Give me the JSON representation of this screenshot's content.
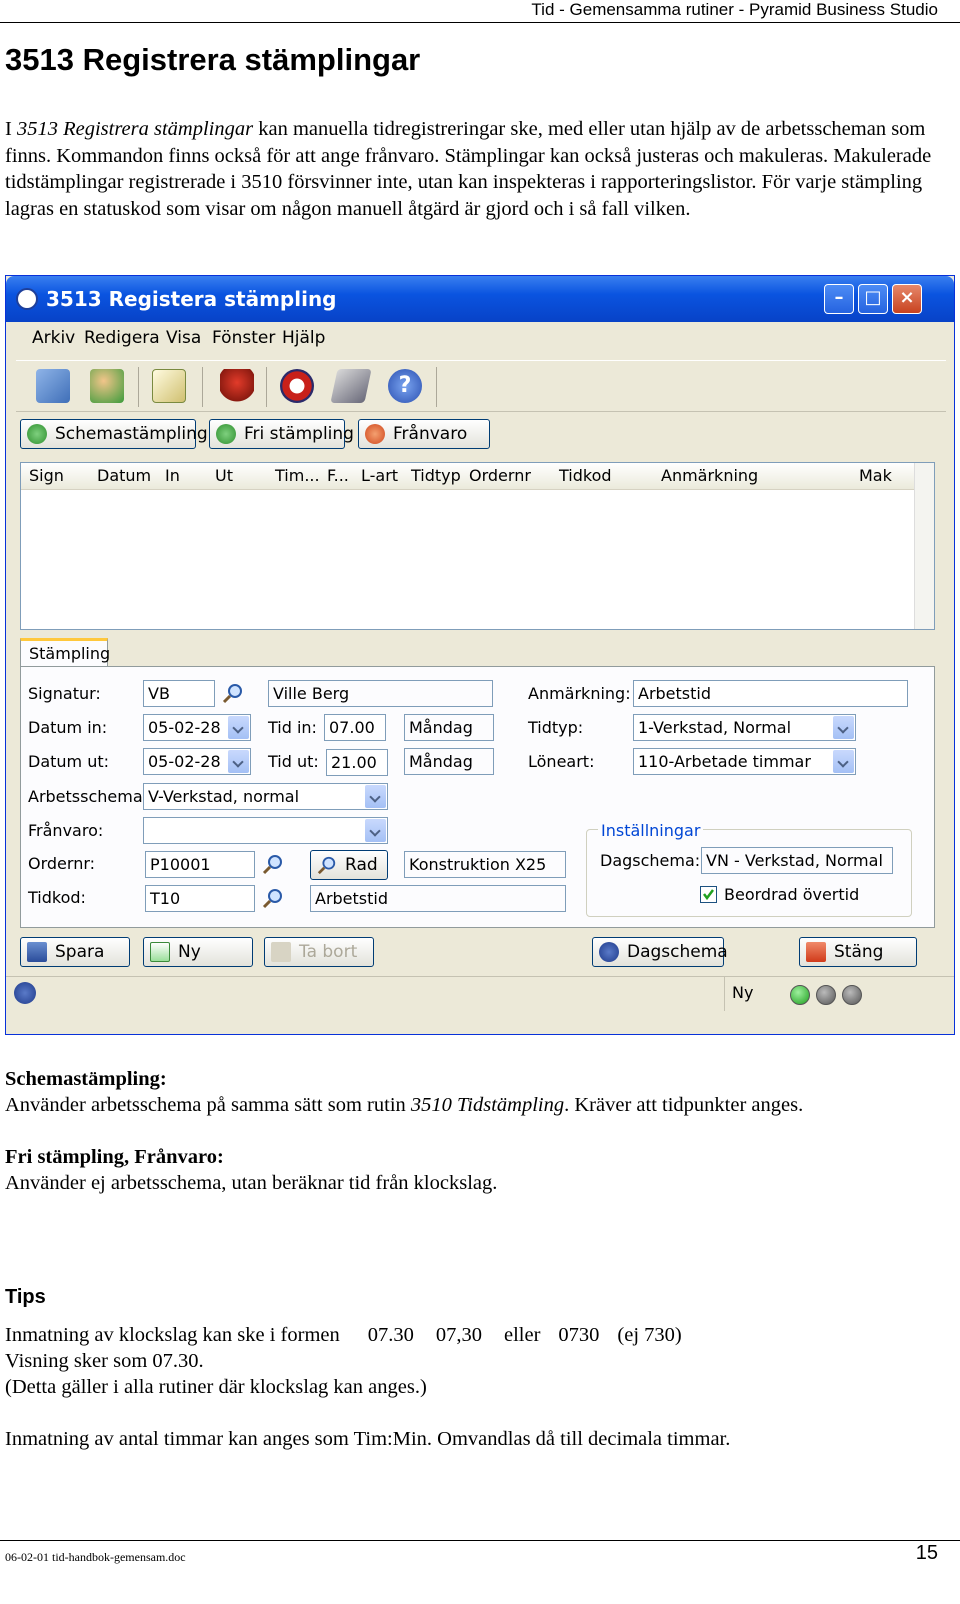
{
  "header": {
    "title": "Tid - Gemensamma rutiner - Pyramid Business Studio"
  },
  "heading": "3513 Registrera stämplingar",
  "intro": {
    "prefix": "I ",
    "italic": "3513 Registrera stämplingar",
    "rest": " kan manuella tidregistreringar ske, med eller utan hjälp av de arbetsscheman som finns. Kommandon finns också för att ange frånvaro. Stämplingar kan också justeras och makuleras. Makulerade tidstämplingar registrerade i 3510 försvinner inte, utan kan inspekteras i rapporteringslistor. För varje stämpling lagras en statuskod som visar om någon manuell åtgärd är gjord och i så fall vilken."
  },
  "window": {
    "title": "3513 Registera stämpling",
    "menu": [
      "Arkiv",
      "Redigera",
      "Visa",
      "Fönster",
      "Hjälp"
    ],
    "mode_buttons": [
      "Schemastämpling",
      "Fri stämpling",
      "Frånvaro"
    ],
    "grid_columns": [
      "Sign",
      "Datum",
      "In",
      "Ut",
      "Tim...",
      "F...",
      "L-art",
      "Tidtyp",
      "Ordernr",
      "Tidkod",
      "Anmärkning",
      "Mak"
    ],
    "tab": "Stämpling",
    "labels": {
      "signatur": "Signatur:",
      "datum_in": "Datum in:",
      "datum_ut": "Datum ut:",
      "arbetsschema": "Arbetsschema:",
      "franvaro": "Frånvaro:",
      "ordernr": "Ordernr:",
      "tidkod": "Tidkod:",
      "tid_in": "Tid in:",
      "tid_ut": "Tid ut:",
      "anmarkning": "Anmärkning:",
      "tidtyp": "Tidtyp:",
      "loneart": "Löneart:"
    },
    "values": {
      "signatur": "VB",
      "namn": "Ville Berg",
      "datum_in": "05-02-28",
      "datum_ut": "05-02-28",
      "tid_in": "07.00",
      "tid_ut": "21.00",
      "dag_in": "Måndag",
      "dag_ut": "Måndag",
      "arbetsschema": "V-Verkstad, normal",
      "franvaro": "",
      "ordernr": "P10001",
      "rad_button": "Rad",
      "order_text": "Konstruktion X25",
      "tidkod": "T10",
      "tidkod_text": "Arbetstid",
      "anmarkning": "Arbetstid",
      "tidtyp": "1-Verkstad, Normal",
      "loneart": "110-Arbetade timmar"
    },
    "settings": {
      "title": "Inställningar",
      "dagschema_label": "Dagschema:",
      "dagschema_value": "VN - Verkstad, Normal",
      "checkbox_label": "Beordrad övertid",
      "checked": true
    },
    "bottom_buttons": {
      "spara": "Spara",
      "ny": "Ny",
      "ta_bort": "Ta bort",
      "dagschema": "Dagschema",
      "stang": "Stäng"
    },
    "status": {
      "mode": "Ny"
    }
  },
  "sections": [
    {
      "title": "Schemastämpling:",
      "text_before": "Använder arbetsschema på samma sätt som rutin ",
      "italic": "3510 Tidstämpling",
      "text_after": ".  Kräver att tidpunkter anges."
    },
    {
      "title": "Fri stämpling, Frånvaro:",
      "text": "Använder ej arbetsschema, utan beräknar tid från klockslag."
    }
  ],
  "tips": {
    "title": "Tips",
    "line1_prefix": "Inmatning av klockslag kan ske i formen",
    "line1_a": "07.30",
    "line1_b": "07,30",
    "line1_c": "eller",
    "line1_d": "0730",
    "line1_e": "(ej 730)",
    "line2": "Visning sker som 07.30.",
    "line3": "(Detta gäller i alla rutiner där klockslag kan anges.)",
    "line4": "Inmatning av antal timmar kan anges som Tim:Min. Omvandlas då till decimala timmar."
  },
  "footer": {
    "file": "06-02-01 tid-handbok-gemensam.doc",
    "page": "15"
  }
}
